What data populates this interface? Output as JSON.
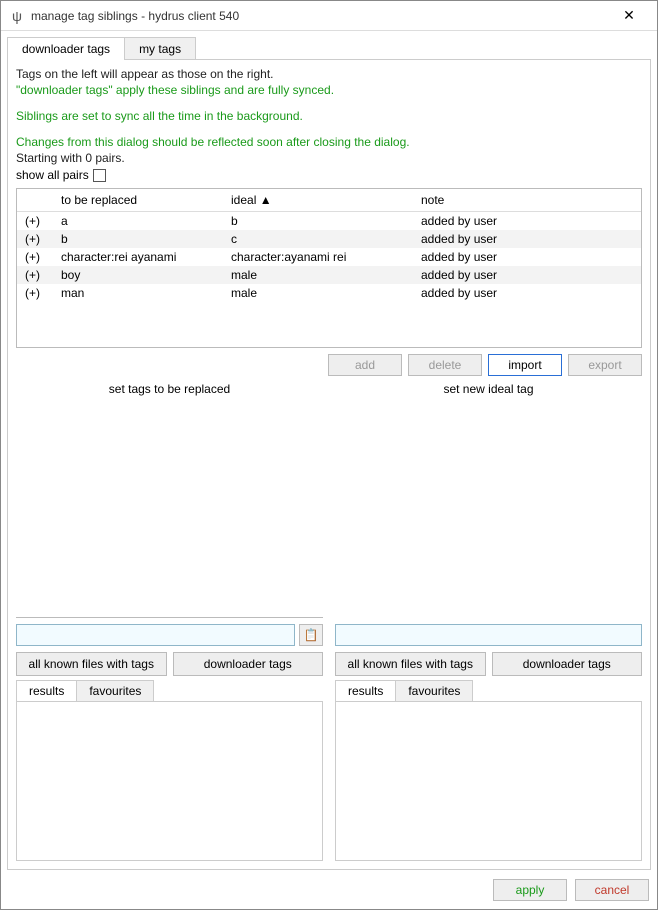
{
  "window": {
    "title": "manage tag siblings - hydrus client 540",
    "icon": "ψ",
    "close": "✕"
  },
  "tabs": [
    {
      "label": "downloader tags",
      "active": true
    },
    {
      "label": "my tags",
      "active": false
    }
  ],
  "info": {
    "line1": "Tags on the left will appear as those on the right.",
    "line2": "\"downloader tags\" apply these siblings and are fully synced.",
    "line3": "Siblings are set to sync all the time in the background.",
    "line4": "Changes from this dialog should be reflected soon after closing the dialog.",
    "line5": "Starting with 0 pairs.",
    "show_all_label": "show all pairs"
  },
  "table": {
    "headers": {
      "sym": "",
      "to_be_replaced": "to be replaced",
      "ideal": "ideal ▲",
      "note": "note"
    },
    "rows": [
      {
        "sym": "(+)",
        "old": "a",
        "ideal": "b",
        "note": "added by user"
      },
      {
        "sym": "(+)",
        "old": "b",
        "ideal": "c",
        "note": "added by user"
      },
      {
        "sym": "(+)",
        "old": "character:rei ayanami",
        "ideal": "character:ayanami rei",
        "note": "added by user"
      },
      {
        "sym": "(+)",
        "old": "boy",
        "ideal": "male",
        "note": "added by user"
      },
      {
        "sym": "(+)",
        "old": "man",
        "ideal": "male",
        "note": "added by user"
      }
    ]
  },
  "buttons": {
    "add": "add",
    "delete": "delete",
    "import": "import",
    "export": "export"
  },
  "panels": {
    "left_header": "set tags to be replaced",
    "right_header": "set new ideal tag",
    "paste_icon": "📋",
    "filter1": "all known files with tags",
    "filter2": "downloader tags",
    "subtab_results": "results",
    "subtab_favourites": "favourites"
  },
  "footer": {
    "apply": "apply",
    "cancel": "cancel"
  }
}
